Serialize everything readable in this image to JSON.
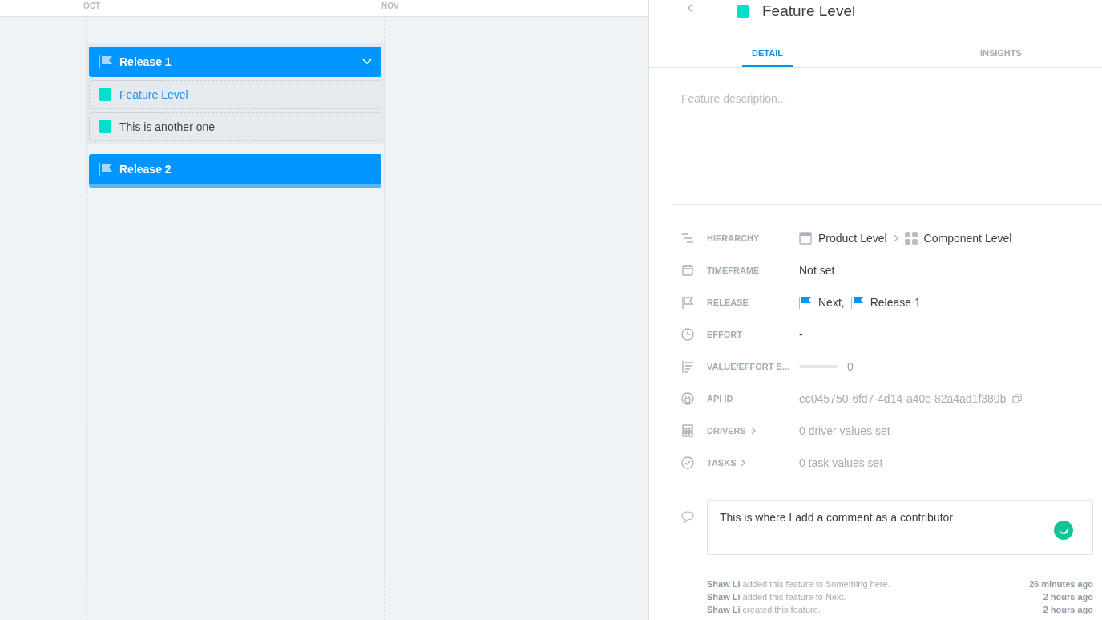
{
  "timeline": {
    "months": [
      "OCT",
      "NOV"
    ],
    "releases": [
      {
        "name": "Release 1",
        "expanded": true,
        "features": [
          {
            "name": "Feature Level",
            "selected": true
          },
          {
            "name": "This is another one",
            "selected": false
          }
        ]
      },
      {
        "name": "Release 2",
        "expanded": false
      }
    ]
  },
  "panel": {
    "title": "Feature Level",
    "tabs": [
      {
        "label": "DETAIL",
        "selected": true
      },
      {
        "label": "INSIGHTS",
        "selected": false
      }
    ],
    "description": {
      "placeholder": "Feature description..."
    },
    "fields": [
      {
        "kind": "hierarchy",
        "label": "HIERARCHY",
        "items": [
          "Product Level",
          "Component Level"
        ]
      },
      {
        "kind": "text",
        "label": "TIMEFRAME",
        "value": "Not set"
      },
      {
        "kind": "releases",
        "label": "RELEASE",
        "items": [
          "Next,",
          "Release 1"
        ]
      },
      {
        "kind": "text",
        "label": "EFFORT",
        "value": "-"
      },
      {
        "kind": "slider",
        "label": "VALUE/EFFORT S...",
        "level": 0,
        "value": "0"
      },
      {
        "kind": "api",
        "label": "API ID",
        "value": "ec045750-6fd7-4d14-a40c-82a4ad1f380b"
      },
      {
        "kind": "link",
        "label": "DRIVERS",
        "value": "0 driver values set"
      },
      {
        "kind": "link",
        "label": "TASKS",
        "value": "0 task values set"
      }
    ],
    "comment": {
      "value": "This is where I add a comment as a contributor"
    },
    "activity": [
      {
        "text": "**Shaw Li** added this feature to Something here.",
        "time": "26 minutes ago"
      },
      {
        "text": "**Shaw Li** added this feature to Next.",
        "time": "2 hours ago"
      },
      {
        "text": "**Shaw Li** created this feature.",
        "time": "2 hours ago"
      }
    ]
  }
}
